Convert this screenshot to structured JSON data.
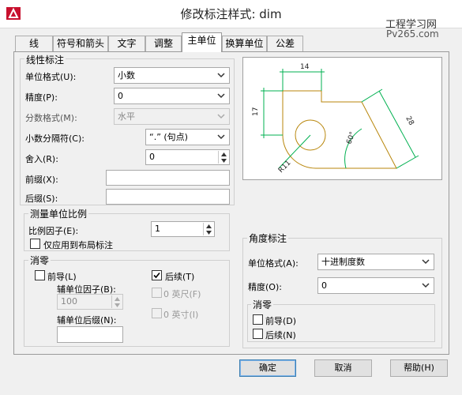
{
  "window": {
    "title": "修改标注样式: dim",
    "watermark_site": "工程学习网",
    "watermark_url": "Pv265.com"
  },
  "tabs": [
    {
      "label": "线",
      "active": false
    },
    {
      "label": "符号和箭头",
      "active": false
    },
    {
      "label": "文字",
      "active": false
    },
    {
      "label": "调整",
      "active": false
    },
    {
      "label": "主单位",
      "active": true
    },
    {
      "label": "换算单位",
      "active": false
    },
    {
      "label": "公差",
      "active": false
    }
  ],
  "linear": {
    "group_label": "线性标注",
    "unit_format_label": "单位格式(U):",
    "unit_format_value": "小数",
    "precision_label": "精度(P):",
    "precision_value": "0",
    "fraction_format_label": "分数格式(M):",
    "fraction_format_value": "水平",
    "decimal_sep_label": "小数分隔符(C):",
    "decimal_sep_value": "“.” (句点)",
    "roundoff_label": "舍入(R):",
    "roundoff_value": "0",
    "prefix_label": "前缀(X):",
    "prefix_value": "",
    "suffix_label": "后缀(S):",
    "suffix_value": ""
  },
  "scale": {
    "group_label": "测量单位比例",
    "factor_label": "比例因子(E):",
    "factor_value": "1",
    "layout_only_label": "仅应用到布局标注",
    "layout_only_checked": false
  },
  "zero_suppression_linear": {
    "group_label": "消零",
    "leading_label": "前导(L)",
    "leading_checked": false,
    "sub_unit_factor_label": "辅单位因子(B):",
    "sub_unit_factor_value": "100",
    "sub_unit_suffix_label": "辅单位后缀(N):",
    "sub_unit_suffix_value": "",
    "trailing_label": "后续(T)",
    "trailing_checked": true,
    "feet_label": "0 英尺(F)",
    "inches_label": "0 英寸(I)"
  },
  "angular": {
    "group_label": "角度标注",
    "unit_format_label": "单位格式(A):",
    "unit_format_value": "十进制度数",
    "precision_label": "精度(O):",
    "precision_value": "0",
    "zero_group_label": "消零",
    "leading_label": "前导(D)",
    "trailing_label": "后续(N)"
  },
  "preview": {
    "dim_top": "14",
    "dim_left": "17",
    "dim_slant": "28",
    "dim_angle": "60°",
    "dim_radius": "R11"
  },
  "buttons": {
    "ok": "确定",
    "cancel": "取消",
    "help": "帮助(H)"
  },
  "colors": {
    "accent": "#3c7fb1",
    "preview_geometry": "#b8860b",
    "preview_dimension": "#00b050"
  }
}
